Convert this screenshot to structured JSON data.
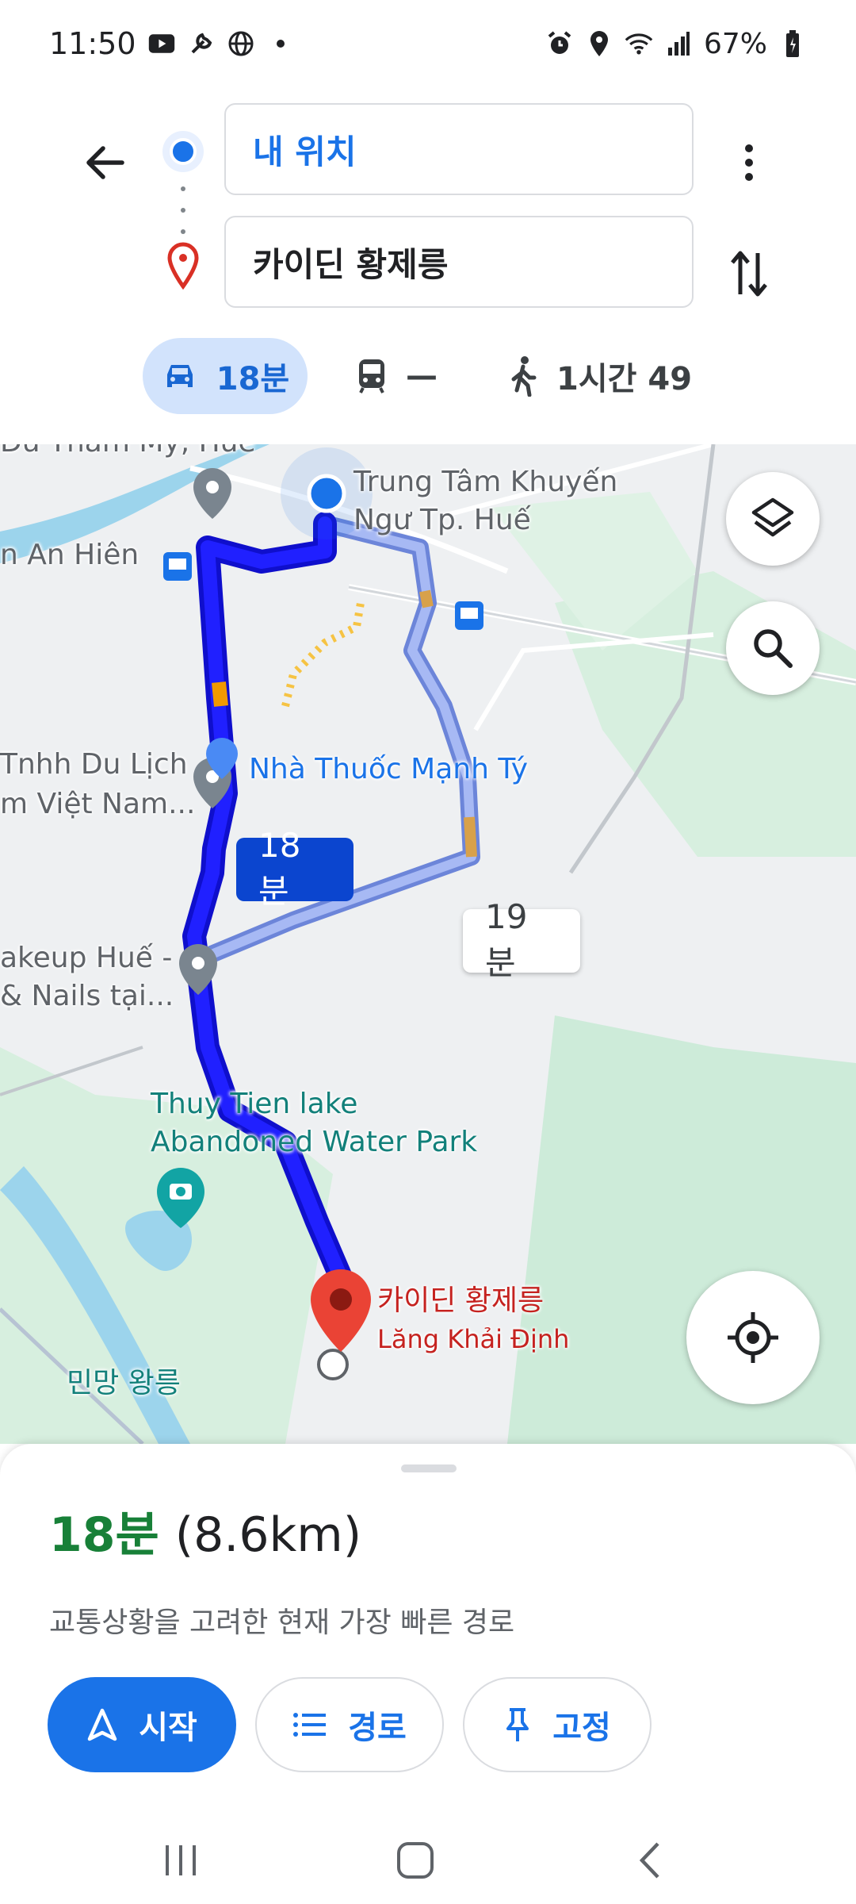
{
  "status_bar": {
    "time": "11:50",
    "battery": "67%",
    "left_icons": [
      "youtube-icon",
      "tool-icon",
      "globe-icon",
      "dot-icon"
    ],
    "right_icons": [
      "alarm-icon",
      "location-icon",
      "wifi-icon",
      "signal-icon",
      "battery-icon"
    ]
  },
  "directions": {
    "origin": "내 위치",
    "destination": "카이딘 황제릉",
    "modes": [
      {
        "name": "car",
        "label": "18분",
        "selected": true
      },
      {
        "name": "transit",
        "label": "—",
        "selected": false
      },
      {
        "name": "walk",
        "label": "1시간 49",
        "selected": false
      }
    ]
  },
  "map": {
    "labels": {
      "top_cut": "Du Thẩm Mỹ, Huế",
      "an_hien": "n An Hiên",
      "trung_tam_1": "Trung Tâm Khuyến",
      "trung_tam_2": "Ngư Tp. Huế",
      "tnhh_1": "Tnhh Du Lịch",
      "tnhh_2": "m Việt Nam...",
      "pharmacy": "Nhà Thuốc Mạnh Tý",
      "makeup_1": "akeup Huế -",
      "makeup_2": "& Nails tại...",
      "lake_1": "Thuy Tien lake",
      "lake_2": "Abandoned Water Park",
      "dest_1": "카이딘 황제릉",
      "dest_2": "Lăng Khải Định",
      "minh_mang": "민망 왕릉"
    },
    "route_primary_time": "18분",
    "route_alt_time": "19분",
    "colors": {
      "route_primary": "#1a1aff",
      "route_alt": "#8aa4f0",
      "traffic": "#f29900",
      "park": "#cdebd9",
      "water": "#9cd4ec"
    }
  },
  "sheet": {
    "duration": "18분",
    "distance": "(8.6km)",
    "description": "교통상황을 고려한 현재 가장 빠른 경로",
    "buttons": {
      "start": "시작",
      "steps": "경로",
      "pin": "고정"
    }
  }
}
